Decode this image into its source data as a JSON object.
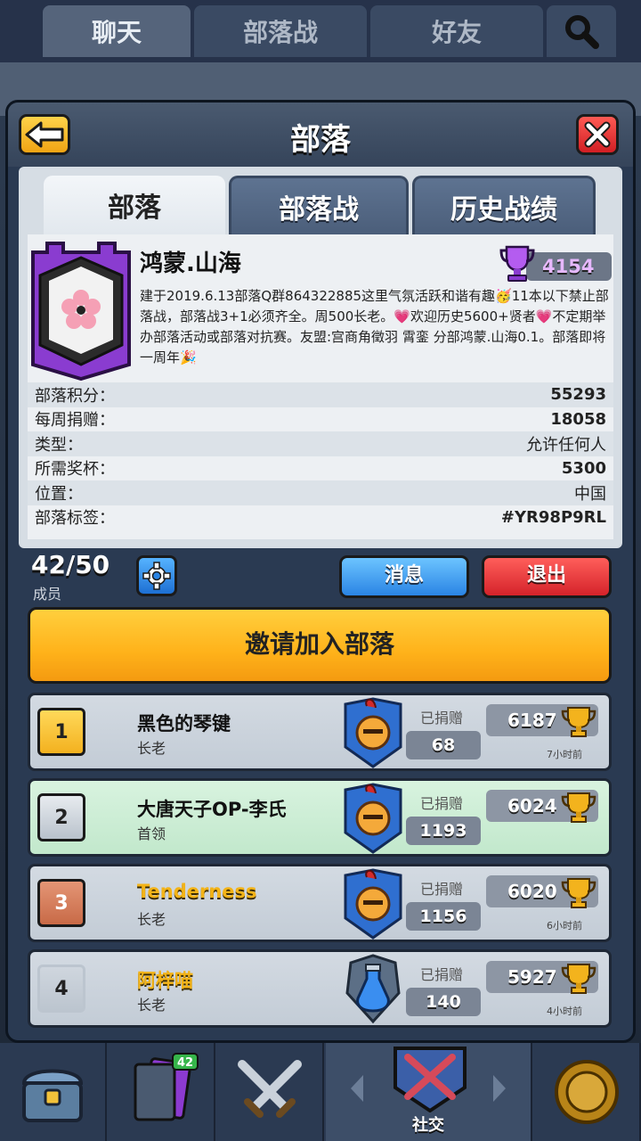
{
  "bg_tabs": [
    {
      "label": "聊天"
    },
    {
      "label": "部落战"
    },
    {
      "label": "好友"
    }
  ],
  "modal": {
    "title": "部落",
    "tabs": [
      {
        "label": "部落"
      },
      {
        "label": "部落战"
      },
      {
        "label": "历史战绩"
      }
    ]
  },
  "clan": {
    "name": "鸿蒙.山海",
    "trophies": "4154",
    "description": "建于2019.6.13部落Q群864322885这里气氛活跃和谐有趣🥳11本以下禁止部落战，部落战3+1必须齐全。周500长老。💗欢迎历史5600+贤者💗不定期举办部落活动或部落对抗赛。友盟:宫商角徵羽 霄銮 分部鸿蒙.山海0.1。部落即将一周年🎉",
    "stats": [
      {
        "label": "部落积分：",
        "value": "55293"
      },
      {
        "label": "每周捐赠：",
        "value": "18058"
      },
      {
        "label": "类型：",
        "value": "允许任何人"
      },
      {
        "label": "所需奖杯：",
        "value": "5300"
      },
      {
        "label": "位置：",
        "value": "中国"
      },
      {
        "label": "部落标签：",
        "value": "#YR98P9RL"
      }
    ]
  },
  "members_bar": {
    "count": "42/50",
    "label": "成员",
    "message_btn": "消息",
    "quit_btn": "退出"
  },
  "invite_btn": "邀请加入部落",
  "donated_label": "已捐赠",
  "members": [
    {
      "rank": "1",
      "name": "黑色的琴键",
      "role": "长老",
      "donated": "68",
      "trophies": "6187",
      "last_seen": "7小时前"
    },
    {
      "rank": "2",
      "name": "大唐天子OP-李氏",
      "role": "首领",
      "donated": "1193",
      "trophies": "6024",
      "last_seen": ""
    },
    {
      "rank": "3",
      "name": "Tenderness",
      "role": "长老",
      "donated": "1156",
      "trophies": "6020",
      "last_seen": "6小时前"
    },
    {
      "rank": "4",
      "name": "阿梓喵",
      "role": "长老",
      "donated": "140",
      "trophies": "5927",
      "last_seen": "4小时前"
    }
  ],
  "bottom_nav": {
    "badge": "42",
    "active_label": "社交"
  },
  "colors": {
    "accent_gold": "#ffb21a",
    "trophy_purple": "#e6b8ff",
    "quit_red": "#d5232a",
    "message_blue": "#2a84e4"
  }
}
